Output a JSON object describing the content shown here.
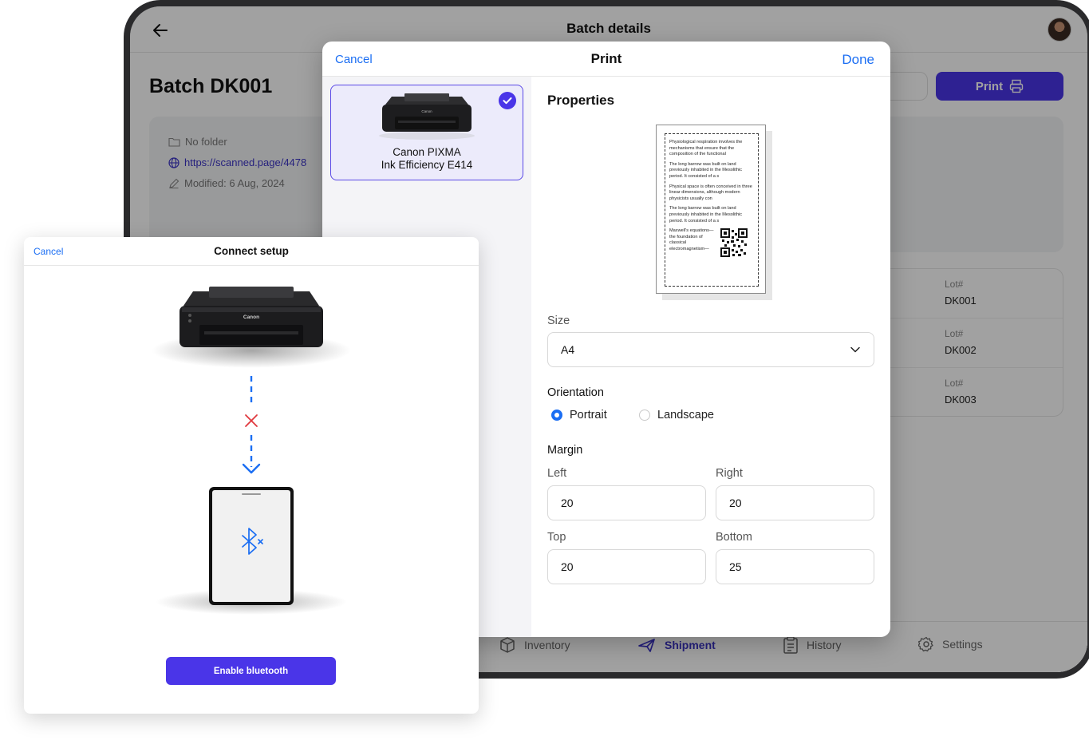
{
  "app": {
    "header_title": "Batch details",
    "batch_title": "Batch DK001",
    "print_label": "Print",
    "info": {
      "folder": "No folder",
      "link": "https://scanned.page/4478",
      "modified": "Modified: 6 Aug, 2024"
    },
    "lots": [
      {
        "label": "Lot#",
        "value": "DK001"
      },
      {
        "label": "Lot#",
        "value": "DK002"
      },
      {
        "label": "Lot#",
        "value": "DK003"
      }
    ],
    "nav": [
      {
        "label": "Inventory",
        "icon": "box-icon",
        "active": false
      },
      {
        "label": "Shipment",
        "icon": "plane-icon",
        "active": true
      },
      {
        "label": "History",
        "icon": "clipboard-icon",
        "active": false
      },
      {
        "label": "Settings",
        "icon": "gear-icon",
        "active": false
      }
    ]
  },
  "print_modal": {
    "cancel_label": "Cancel",
    "title": "Print",
    "done_label": "Done",
    "printer": {
      "name_line1": "Canon PIXMA",
      "name_line2": "Ink Efficiency E414",
      "selected": true
    },
    "properties_title": "Properties",
    "preview_paragraphs": [
      "Physiological respiration involves the mechanisms that ensure that the composition of the functional",
      "The long barrow was built on land previously inhabited in the Mesolithic period. It consisted of a s",
      "Physical space is often conceived in three linear dimensions, although modern physicists usually con",
      "The long barrow was built on land previously inhabited in the Mesolithic period. It consisted of a s",
      "Maxwell's equations—the foundation of classical electromagnetism—"
    ],
    "size_label": "Size",
    "size_value": "A4",
    "orientation_label": "Orientation",
    "orientation_options": [
      "Portrait",
      "Landscape"
    ],
    "orientation_selected": "Portrait",
    "margin_label": "Margin",
    "margins": {
      "left_label": "Left",
      "left": "20",
      "right_label": "Right",
      "right": "20",
      "top_label": "Top",
      "top": "20",
      "bottom_label": "Bottom",
      "bottom": "25"
    }
  },
  "connect_modal": {
    "cancel_label": "Cancel",
    "title": "Connect setup",
    "enable_label": "Enable bluetooth"
  },
  "colors": {
    "accent": "#4a35e8",
    "link": "#1b6ef3",
    "error": "#e0383e"
  }
}
